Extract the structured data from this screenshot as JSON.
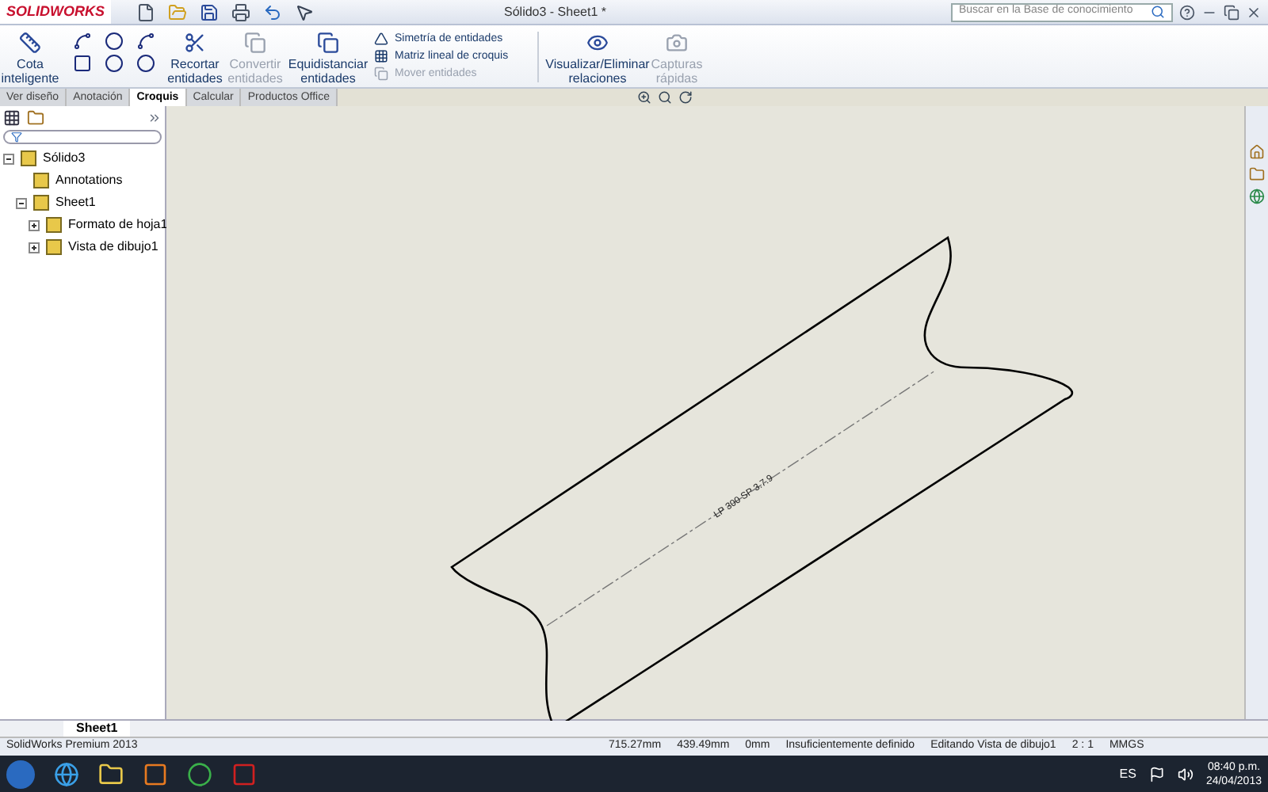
{
  "window": {
    "app": "SOLIDWORKS",
    "title": "Sólido3 - Sheet1 *",
    "search": {
      "placeholder": "Buscar en la Base de conocimiento"
    }
  },
  "ribbon": {
    "big_buttons": [
      {
        "label": "Cota inteligente",
        "disabled": false
      },
      {
        "label": "Recortar entidades",
        "disabled": false
      },
      {
        "label": "Convertir entidades",
        "disabled": true
      },
      {
        "label": "Equidistanciar entidades",
        "disabled": false
      }
    ],
    "list_items": [
      {
        "label": "Simetría de entidades",
        "disabled": false
      },
      {
        "label": "Matriz lineal de croquis",
        "disabled": false
      },
      {
        "label": "Mover entidades",
        "disabled": true
      }
    ],
    "more_buttons": [
      {
        "label": "Visualizar/Eliminar relaciones",
        "disabled": false
      },
      {
        "label": "Capturas rápidas",
        "disabled": true
      }
    ]
  },
  "tabs": [
    {
      "label": "Ver diseño",
      "selected": false
    },
    {
      "label": "Anotación",
      "selected": false
    },
    {
      "label": "Croquis",
      "selected": true
    },
    {
      "label": "Calcular",
      "selected": false
    },
    {
      "label": "Productos Office",
      "selected": false
    }
  ],
  "tree": [
    {
      "label": "Sólido3",
      "expanded": true,
      "children": [
        {
          "label": "Annotations"
        },
        {
          "label": "Sheet1",
          "expanded": true,
          "children": [
            {
              "label": "Formato de hoja1",
              "expanded": false
            },
            {
              "label": "Vista de dibujo1",
              "expanded": false
            }
          ]
        }
      ]
    }
  ],
  "drawing": {
    "dimension_label": "LP 300 SP 3.7.9"
  },
  "sheet_tabs": [
    {
      "label": "Sheet1",
      "selected": true
    }
  ],
  "status_bar": {
    "product": "SolidWorks Premium 2013",
    "items": [
      "715.27mm",
      "439.49mm",
      "0mm",
      "Insuficientemente definido",
      "Editando Vista de dibujo1",
      "2 : 1",
      "MMGS"
    ]
  },
  "taskbar": {
    "language": "ES",
    "time": "08:40 p.m.",
    "date": "24/04/2013"
  }
}
